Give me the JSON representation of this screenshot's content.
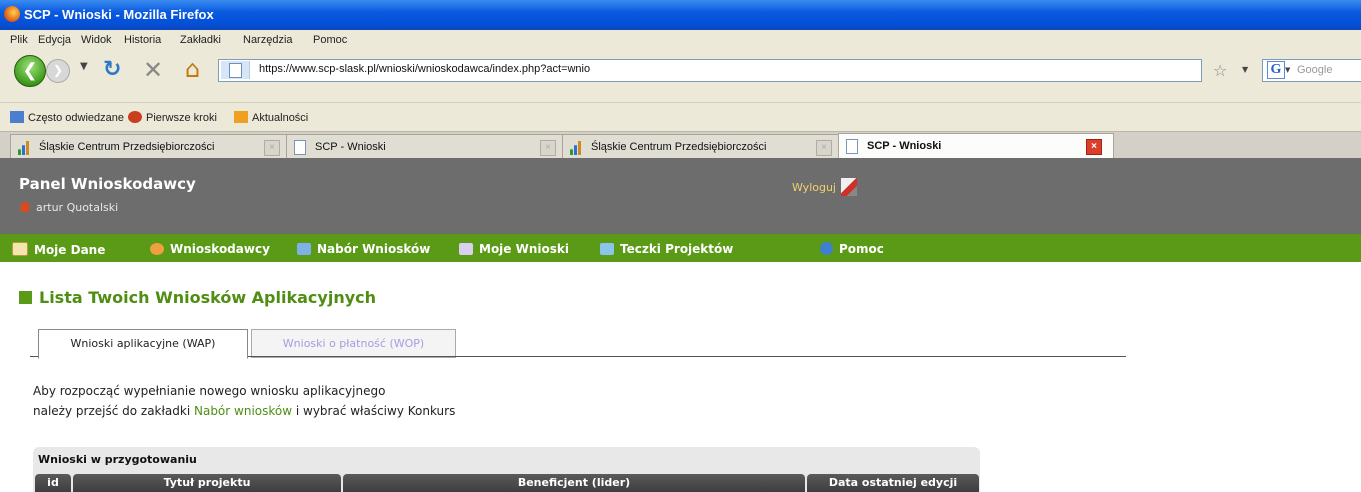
{
  "window": {
    "title": "SCP - Wnioski - Mozilla Firefox"
  },
  "menu": [
    "Plik",
    "Edycja",
    "Widok",
    "Historia",
    "Zakładki",
    "Narzędzia",
    "Pomoc"
  ],
  "navbar": {
    "url": "https://www.scp-slask.pl/wnioski/wnioskodawca/index.php?act=wnio",
    "search_placeholder": "Google"
  },
  "bookmarks": [
    "Często odwiedzane",
    "Pierwsze kroki",
    "Aktualności"
  ],
  "tabs": [
    {
      "label": "Śląskie Centrum Przedsiębiorczości"
    },
    {
      "label": "SCP - Wnioski"
    },
    {
      "label": "Śląskie Centrum Przedsiębiorczości"
    },
    {
      "label": "SCP - Wnioski"
    }
  ],
  "site": {
    "panel_title": "Panel Wnioskodawcy",
    "user": "artur Quotalski",
    "logout": "Wyloguj"
  },
  "nav": [
    "Moje Dane",
    "Wnioskodawcy",
    "Nabór Wniosków",
    "Moje Wnioski",
    "Teczki Projektów",
    "Pomoc"
  ],
  "content": {
    "heading": "Lista Twoich Wniosków Aplikacyjnych",
    "tab_wap": "Wnioski aplikacyjne (WAP)",
    "tab_wop": "Wnioski o płatność (WOP)",
    "info_line1": "Aby rozpocząć wypełnianie nowego wniosku aplikacyjnego",
    "info_line2_a": "należy przejść do zakładki ",
    "info_link": "Nabór wniosków",
    "info_line2_b": " i wybrać właściwy Konkurs",
    "table_caption": "Wnioski w przygotowaniu",
    "columns": [
      "id",
      "Tytuł projektu",
      "Beneficjent (lider)",
      "Data ostatniej edycji"
    ]
  }
}
